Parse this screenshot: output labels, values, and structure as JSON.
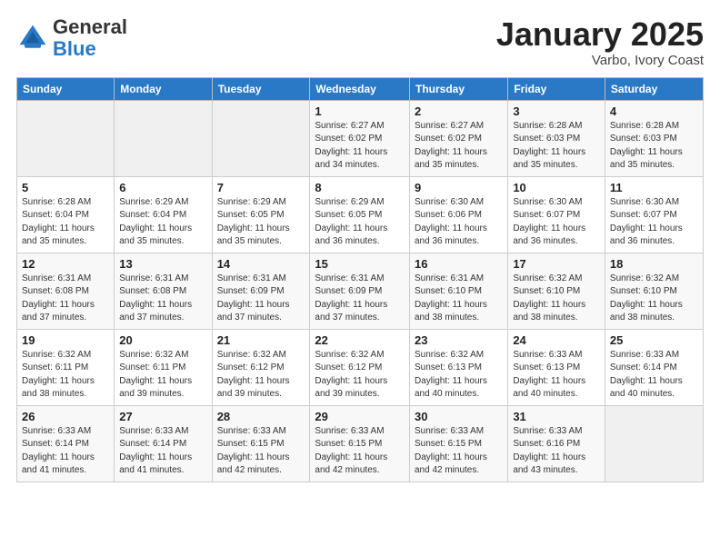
{
  "logo": {
    "general": "General",
    "blue": "Blue"
  },
  "title": "January 2025",
  "subtitle": "Varbo, Ivory Coast",
  "days_header": [
    "Sunday",
    "Monday",
    "Tuesday",
    "Wednesday",
    "Thursday",
    "Friday",
    "Saturday"
  ],
  "weeks": [
    [
      {
        "day": "",
        "info": ""
      },
      {
        "day": "",
        "info": ""
      },
      {
        "day": "",
        "info": ""
      },
      {
        "day": "1",
        "info": "Sunrise: 6:27 AM\nSunset: 6:02 PM\nDaylight: 11 hours and 34 minutes."
      },
      {
        "day": "2",
        "info": "Sunrise: 6:27 AM\nSunset: 6:02 PM\nDaylight: 11 hours and 35 minutes."
      },
      {
        "day": "3",
        "info": "Sunrise: 6:28 AM\nSunset: 6:03 PM\nDaylight: 11 hours and 35 minutes."
      },
      {
        "day": "4",
        "info": "Sunrise: 6:28 AM\nSunset: 6:03 PM\nDaylight: 11 hours and 35 minutes."
      }
    ],
    [
      {
        "day": "5",
        "info": "Sunrise: 6:28 AM\nSunset: 6:04 PM\nDaylight: 11 hours and 35 minutes."
      },
      {
        "day": "6",
        "info": "Sunrise: 6:29 AM\nSunset: 6:04 PM\nDaylight: 11 hours and 35 minutes."
      },
      {
        "day": "7",
        "info": "Sunrise: 6:29 AM\nSunset: 6:05 PM\nDaylight: 11 hours and 35 minutes."
      },
      {
        "day": "8",
        "info": "Sunrise: 6:29 AM\nSunset: 6:05 PM\nDaylight: 11 hours and 36 minutes."
      },
      {
        "day": "9",
        "info": "Sunrise: 6:30 AM\nSunset: 6:06 PM\nDaylight: 11 hours and 36 minutes."
      },
      {
        "day": "10",
        "info": "Sunrise: 6:30 AM\nSunset: 6:07 PM\nDaylight: 11 hours and 36 minutes."
      },
      {
        "day": "11",
        "info": "Sunrise: 6:30 AM\nSunset: 6:07 PM\nDaylight: 11 hours and 36 minutes."
      }
    ],
    [
      {
        "day": "12",
        "info": "Sunrise: 6:31 AM\nSunset: 6:08 PM\nDaylight: 11 hours and 37 minutes."
      },
      {
        "day": "13",
        "info": "Sunrise: 6:31 AM\nSunset: 6:08 PM\nDaylight: 11 hours and 37 minutes."
      },
      {
        "day": "14",
        "info": "Sunrise: 6:31 AM\nSunset: 6:09 PM\nDaylight: 11 hours and 37 minutes."
      },
      {
        "day": "15",
        "info": "Sunrise: 6:31 AM\nSunset: 6:09 PM\nDaylight: 11 hours and 37 minutes."
      },
      {
        "day": "16",
        "info": "Sunrise: 6:31 AM\nSunset: 6:10 PM\nDaylight: 11 hours and 38 minutes."
      },
      {
        "day": "17",
        "info": "Sunrise: 6:32 AM\nSunset: 6:10 PM\nDaylight: 11 hours and 38 minutes."
      },
      {
        "day": "18",
        "info": "Sunrise: 6:32 AM\nSunset: 6:10 PM\nDaylight: 11 hours and 38 minutes."
      }
    ],
    [
      {
        "day": "19",
        "info": "Sunrise: 6:32 AM\nSunset: 6:11 PM\nDaylight: 11 hours and 38 minutes."
      },
      {
        "day": "20",
        "info": "Sunrise: 6:32 AM\nSunset: 6:11 PM\nDaylight: 11 hours and 39 minutes."
      },
      {
        "day": "21",
        "info": "Sunrise: 6:32 AM\nSunset: 6:12 PM\nDaylight: 11 hours and 39 minutes."
      },
      {
        "day": "22",
        "info": "Sunrise: 6:32 AM\nSunset: 6:12 PM\nDaylight: 11 hours and 39 minutes."
      },
      {
        "day": "23",
        "info": "Sunrise: 6:32 AM\nSunset: 6:13 PM\nDaylight: 11 hours and 40 minutes."
      },
      {
        "day": "24",
        "info": "Sunrise: 6:33 AM\nSunset: 6:13 PM\nDaylight: 11 hours and 40 minutes."
      },
      {
        "day": "25",
        "info": "Sunrise: 6:33 AM\nSunset: 6:14 PM\nDaylight: 11 hours and 40 minutes."
      }
    ],
    [
      {
        "day": "26",
        "info": "Sunrise: 6:33 AM\nSunset: 6:14 PM\nDaylight: 11 hours and 41 minutes."
      },
      {
        "day": "27",
        "info": "Sunrise: 6:33 AM\nSunset: 6:14 PM\nDaylight: 11 hours and 41 minutes."
      },
      {
        "day": "28",
        "info": "Sunrise: 6:33 AM\nSunset: 6:15 PM\nDaylight: 11 hours and 42 minutes."
      },
      {
        "day": "29",
        "info": "Sunrise: 6:33 AM\nSunset: 6:15 PM\nDaylight: 11 hours and 42 minutes."
      },
      {
        "day": "30",
        "info": "Sunrise: 6:33 AM\nSunset: 6:15 PM\nDaylight: 11 hours and 42 minutes."
      },
      {
        "day": "31",
        "info": "Sunrise: 6:33 AM\nSunset: 6:16 PM\nDaylight: 11 hours and 43 minutes."
      },
      {
        "day": "",
        "info": ""
      }
    ]
  ]
}
